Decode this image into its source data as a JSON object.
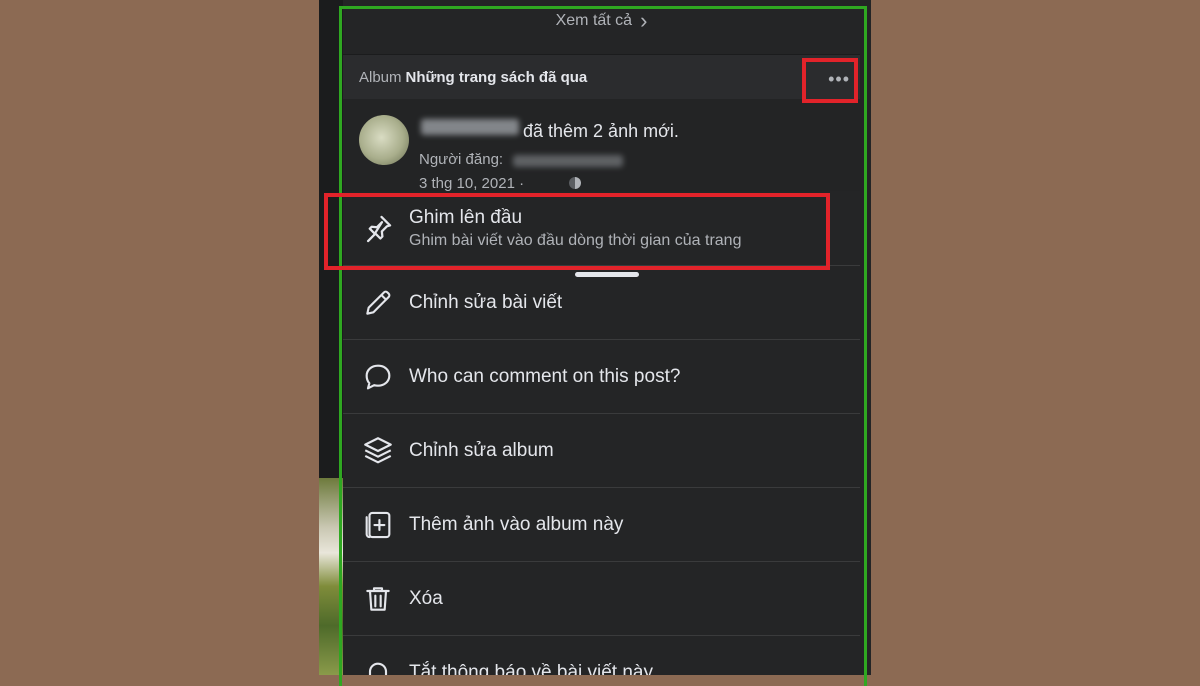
{
  "header": {
    "see_all": "Xem tất cả",
    "see_all_arrow": "›"
  },
  "album": {
    "label": "Album",
    "name": "Những trang sách đã qua",
    "more": "•••"
  },
  "post": {
    "action_text": "đã thêm 2 ảnh mới.",
    "author_label": "Người đăng:",
    "date": "3 thg 10, 2021 ·"
  },
  "menu": {
    "items": [
      {
        "label": "Ghim lên đầu",
        "sub": "Ghim bài viết vào đầu dòng thời gian của trang",
        "icon": "pin-icon"
      },
      {
        "label": "Chỉnh sửa bài viết",
        "icon": "pencil-icon"
      },
      {
        "label": "Who can comment on this post?",
        "icon": "comment-icon"
      },
      {
        "label": "Chỉnh sửa album",
        "icon": "layers-icon"
      },
      {
        "label": "Thêm ảnh vào album này",
        "icon": "add-photo-icon"
      },
      {
        "label": "Xóa",
        "icon": "trash-icon"
      },
      {
        "label": "Tắt thông báo về bài viết này",
        "icon": "bell-icon"
      }
    ]
  },
  "colors": {
    "highlight": "#e2232a",
    "frame": "#2fa821",
    "background": "#8c6a53",
    "menu_bg": "#242526"
  }
}
